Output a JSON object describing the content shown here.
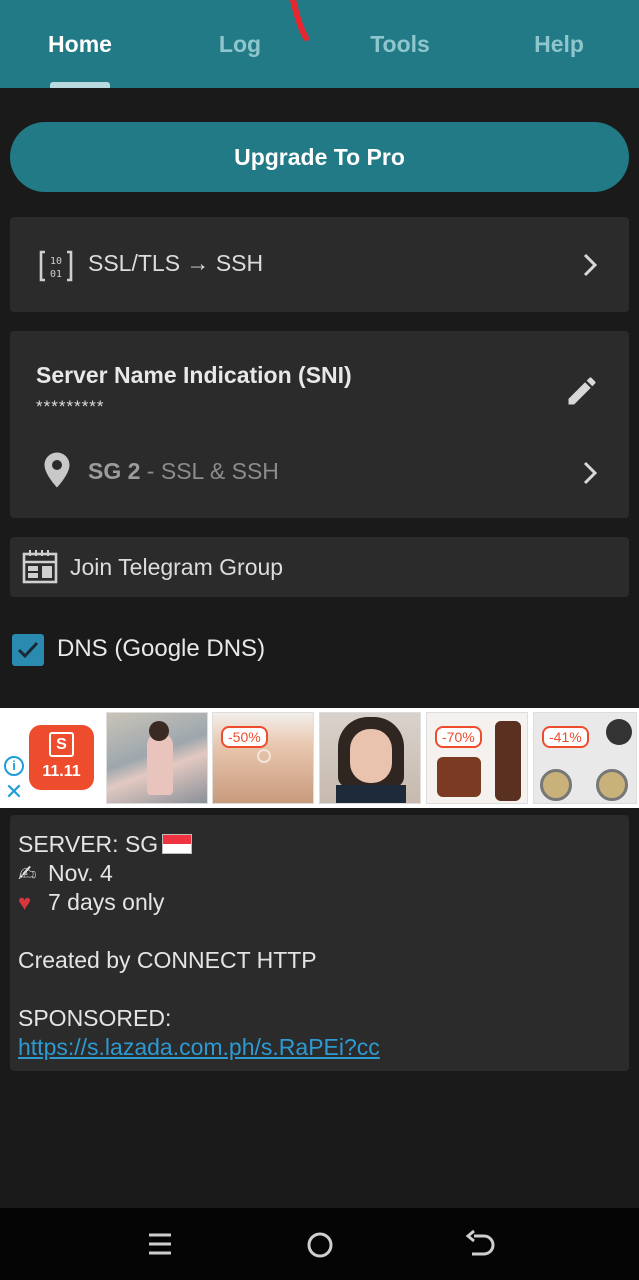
{
  "tabs": [
    {
      "label": "Home",
      "active": true
    },
    {
      "label": "Log",
      "active": false
    },
    {
      "label": "Tools",
      "active": false
    },
    {
      "label": "Help",
      "active": false
    }
  ],
  "upgrade_label": "Upgrade To Pro",
  "protocol": {
    "label": "SSL/TLS → SSH",
    "icon": "binary-icon"
  },
  "sni": {
    "title": "Server Name Indication (SNI)",
    "value": "*********",
    "server_name": "SG 2",
    "server_detail": " - SSL & SSH"
  },
  "telegram": {
    "label": "Join Telegram Group",
    "icon": "calendar-icon"
  },
  "dns": {
    "label": "DNS (Google DNS)",
    "checked": true
  },
  "ad": {
    "event_label": "11.11",
    "shop_letter": "S",
    "discounts": [
      "-50%",
      "-70%",
      "-41%"
    ]
  },
  "info": {
    "server_line": "SERVER: SG",
    "date_line": "Nov. 4",
    "days_line": "7 days only",
    "created_by": "Created by CONNECT HTTP",
    "sponsored": "SPONSORED:",
    "link": "https://s.lazada.com.ph/s.RaPEi?cc"
  },
  "colors": {
    "accent": "#217a86",
    "background": "#1a1a1a",
    "card": "#2b2b2b",
    "link": "#2d9ad2",
    "shopee_orange": "#ee4d2d"
  }
}
